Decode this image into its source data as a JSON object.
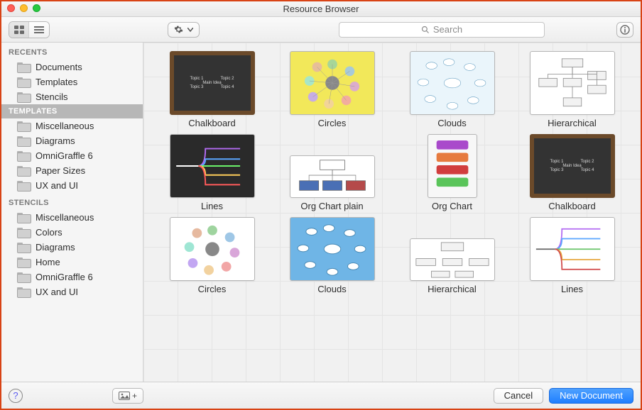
{
  "window": {
    "title": "Resource Browser"
  },
  "search": {
    "placeholder": "Search"
  },
  "sidebar": {
    "sections": [
      {
        "header": "RECENTS",
        "selected": false,
        "items": [
          {
            "label": "Documents"
          },
          {
            "label": "Templates"
          },
          {
            "label": "Stencils"
          }
        ]
      },
      {
        "header": "TEMPLATES",
        "selected": true,
        "items": [
          {
            "label": "Miscellaneous"
          },
          {
            "label": "Diagrams"
          },
          {
            "label": "OmniGraffle 6"
          },
          {
            "label": "Paper Sizes"
          },
          {
            "label": "UX and UI"
          }
        ]
      },
      {
        "header": "STENCILS",
        "selected": false,
        "items": [
          {
            "label": "Miscellaneous"
          },
          {
            "label": "Colors"
          },
          {
            "label": "Diagrams"
          },
          {
            "label": "Home"
          },
          {
            "label": "OmniGraffle 6"
          },
          {
            "label": "UX and UI"
          }
        ]
      }
    ]
  },
  "grid": {
    "items": [
      {
        "label": "Chalkboard",
        "kind": "chalk"
      },
      {
        "label": "Circles",
        "kind": "circles"
      },
      {
        "label": "Clouds",
        "kind": "clouds"
      },
      {
        "label": "Hierarchical",
        "kind": "hier"
      },
      {
        "label": "Lines",
        "kind": "lines"
      },
      {
        "label": "Org Chart plain",
        "kind": "org"
      },
      {
        "label": "Org Chart",
        "kind": "org2"
      },
      {
        "label": "Chalkboard",
        "kind": "chalk"
      },
      {
        "label": "Circles",
        "kind": "circles2"
      },
      {
        "label": "Clouds",
        "kind": "clouds"
      },
      {
        "label": "Hierarchical",
        "kind": "hier2"
      },
      {
        "label": "Lines",
        "kind": "lines2"
      }
    ]
  },
  "chalk": {
    "t1": "Topic 1",
    "t2": "Topic 2",
    "main": "Main Idea",
    "t3": "Topic 3",
    "t4": "Topic 4"
  },
  "footer": {
    "cancel": "Cancel",
    "primary": "New Document"
  }
}
